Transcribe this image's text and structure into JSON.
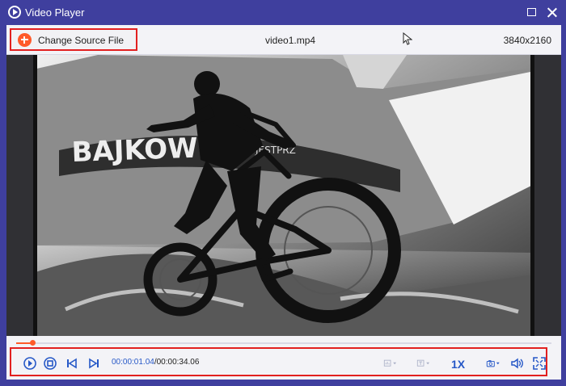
{
  "window": {
    "title": "Video Player",
    "icons": {
      "app": "play-logo-icon",
      "maximize": "maximize-icon",
      "close": "close-icon"
    }
  },
  "toolbar": {
    "change_source_label": "Change Source File",
    "file_name": "video1.mp4",
    "resolution": "3840x2160",
    "change_source_icon": "plus-circle-icon",
    "cursor_icon": "mouse-cursor-icon"
  },
  "player": {
    "current_time": "00:00:01.04",
    "total_time": "/00:00:34.06",
    "progress_fraction": 0.03,
    "speed_label": "1X",
    "controls": [
      "play-icon",
      "stop-icon",
      "previous-frame-icon",
      "next-frame-icon",
      "chart-dropdown-icon",
      "text-dropdown-icon",
      "camera-dropdown-icon",
      "volume-icon",
      "fullscreen-icon"
    ]
  },
  "colors": {
    "window_chrome": "#3f3f9e",
    "control_accent": "#2658c7",
    "highlight_red": "#e22020",
    "progress_orange": "#ff5a2a"
  }
}
